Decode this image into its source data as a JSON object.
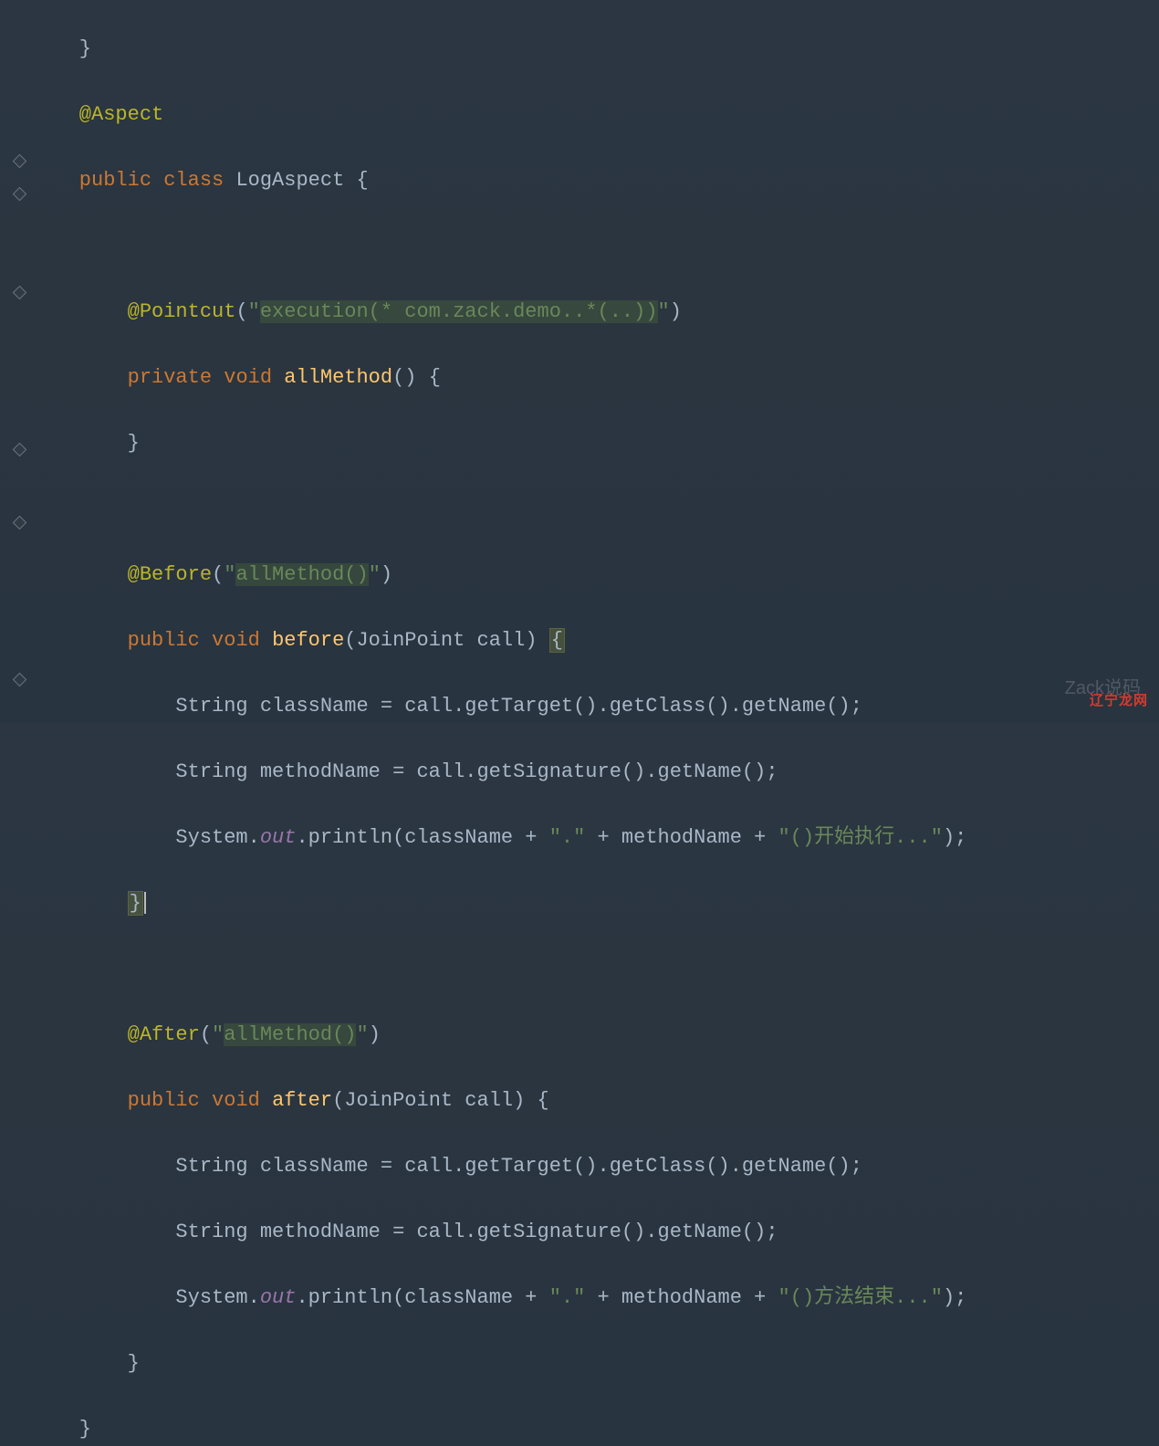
{
  "code": {
    "line1": "    }",
    "line2_a": "    @Aspect",
    "line3_kw1": "    public",
    "line3_kw2": "class",
    "line3_name": "LogAspect {",
    "line5_ann": "        @Pointcut",
    "line5_paren1": "(",
    "line5_q1": "\"",
    "line5_exec": "execution",
    "line5_rest": "(* com.zack.demo..*(..))",
    "line5_q2": "\"",
    "line5_paren2": ")",
    "line6_kw1": "        private",
    "line6_kw2": "void",
    "line6_m": "allMethod",
    "line6_rest": "() {",
    "line7": "        }",
    "line9_ann": "        @Before",
    "line9_paren1": "(",
    "line9_q1": "\"",
    "line9_allm": "allMethod()",
    "line9_q2": "\"",
    "line9_paren2": ")",
    "line10_kw1": "        public",
    "line10_kw2": "void",
    "line10_m": "before",
    "line10_params": "(JoinPoint call) ",
    "line10_brace": "{",
    "line11": "            String className = call.getTarget().getClass().getName();",
    "line12": "            String methodName = call.getSignature().getName();",
    "line13_a": "            System.",
    "line13_out": "out",
    "line13_b": ".println(className + ",
    "line13_s1": "\".\"",
    "line13_c": " + methodName + ",
    "line13_s2": "\"()开始执行...\"",
    "line13_d": ");",
    "line14_brace": "}",
    "line16_ann": "        @After",
    "line16_paren1": "(",
    "line16_q1": "\"",
    "line16_allm": "allMethod()",
    "line16_q2": "\"",
    "line16_paren2": ")",
    "line17_kw1": "        public",
    "line17_kw2": "void",
    "line17_m": "after",
    "line17_params": "(JoinPoint call) {",
    "line18": "            String className = call.getTarget().getClass().getName();",
    "line19": "            String methodName = call.getSignature().getName();",
    "line20_a": "            System.",
    "line20_out": "out",
    "line20_b": ".println(className + ",
    "line20_s1": "\".\"",
    "line20_c": " + methodName + ",
    "line20_s2": "\"()方法结束...\"",
    "line20_d": ");",
    "line21": "        }",
    "line22": "    }"
  },
  "watermark_gray": "Zack说码",
  "watermark_red": "辽宁龙网"
}
